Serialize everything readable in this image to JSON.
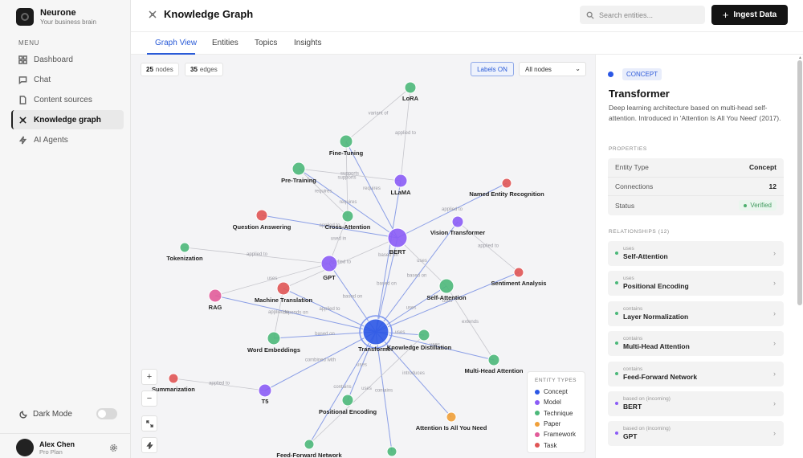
{
  "brand": {
    "name": "Neurone",
    "tagline": "Your business brain"
  },
  "sidebar": {
    "menu_title": "MENU",
    "items": [
      {
        "label": "Dashboard",
        "icon": "grid-icon"
      },
      {
        "label": "Chat",
        "icon": "chat-icon"
      },
      {
        "label": "Content sources",
        "icon": "file-icon"
      },
      {
        "label": "Knowledge graph",
        "icon": "graph-icon",
        "active": true
      },
      {
        "label": "AI Agents",
        "icon": "bolt-icon"
      }
    ],
    "dark_mode_label": "Dark Mode",
    "dark_mode_on": false
  },
  "user": {
    "name": "Alex Chen",
    "plan": "Pro Plan"
  },
  "header": {
    "title": "Knowledge Graph",
    "search_placeholder": "Search entities...",
    "ingest_label": "Ingest Data",
    "ingest_plus": "+"
  },
  "tabs": [
    {
      "label": "Graph View",
      "active": true
    },
    {
      "label": "Entities"
    },
    {
      "label": "Topics"
    },
    {
      "label": "Insights"
    }
  ],
  "graph": {
    "nodes_count": "25",
    "nodes_label": "nodes",
    "edges_count": "35",
    "edges_label": "edges",
    "labels_toggle": "Labels ON",
    "filter_value": "All nodes",
    "zoom_in": "+",
    "zoom_out": "−",
    "legend_title": "ENTITY TYPES",
    "legend": [
      {
        "label": "Concept",
        "color": "#2b57e5"
      },
      {
        "label": "Model",
        "color": "#8b5cf6"
      },
      {
        "label": "Technique",
        "color": "#4cb87a"
      },
      {
        "label": "Paper",
        "color": "#f0a03a"
      },
      {
        "label": "Framework",
        "color": "#e25c9a"
      },
      {
        "label": "Task",
        "color": "#e05555"
      }
    ],
    "nodes": [
      {
        "id": "transformer",
        "label": "Transformer",
        "type": "Concept"
      },
      {
        "id": "bert",
        "label": "BERT",
        "type": "Model"
      },
      {
        "id": "gpt",
        "label": "GPT",
        "type": "Model"
      },
      {
        "id": "llama",
        "label": "LLaMA",
        "type": "Model"
      },
      {
        "id": "t5",
        "label": "T5",
        "type": "Model"
      },
      {
        "id": "vit",
        "label": "Vision Transformer",
        "type": "Model"
      },
      {
        "id": "lora",
        "label": "LoRA",
        "type": "Technique"
      },
      {
        "id": "finetuning",
        "label": "Fine-Tuning",
        "type": "Technique"
      },
      {
        "id": "pretraining",
        "label": "Pre-Training",
        "type": "Technique"
      },
      {
        "id": "crossattn",
        "label": "Cross-Attention",
        "type": "Technique"
      },
      {
        "id": "selfattn",
        "label": "Self-Attention",
        "type": "Technique"
      },
      {
        "id": "tokenization",
        "label": "Tokenization",
        "type": "Technique"
      },
      {
        "id": "wordemb",
        "label": "Word Embeddings",
        "type": "Technique"
      },
      {
        "id": "distill",
        "label": "Knowledge Distillation",
        "type": "Technique"
      },
      {
        "id": "mha",
        "label": "Multi-Head Attention",
        "type": "Technique"
      },
      {
        "id": "posenc",
        "label": "Positional Encoding",
        "type": "Technique"
      },
      {
        "id": "ffn",
        "label": "Feed-Forward Network",
        "type": "Technique"
      },
      {
        "id": "layernorm",
        "label": "",
        "type": "Technique"
      },
      {
        "id": "ner",
        "label": "Named Entity Recognition",
        "type": "Task"
      },
      {
        "id": "qa",
        "label": "Question Answering",
        "type": "Task"
      },
      {
        "id": "mt",
        "label": "Machine Translation",
        "type": "Task"
      },
      {
        "id": "sentiment",
        "label": "Sentiment Analysis",
        "type": "Task"
      },
      {
        "id": "summ",
        "label": "Summarization",
        "type": "Task"
      },
      {
        "id": "rag",
        "label": "RAG",
        "type": "Framework"
      },
      {
        "id": "aiayn",
        "label": "Attention Is All You Need",
        "type": "Paper"
      }
    ],
    "edges": [
      {
        "from": "lora",
        "to": "finetuning",
        "label": "variant of"
      },
      {
        "from": "lora",
        "to": "llama",
        "label": "applied to"
      },
      {
        "from": "finetuning",
        "to": "bert",
        "label": "requires"
      },
      {
        "from": "finetuning",
        "to": "crossattn",
        "label": "supports"
      },
      {
        "from": "pretraining",
        "to": "llama",
        "label": "supports"
      },
      {
        "from": "pretraining",
        "to": "bert",
        "label": "requires"
      },
      {
        "from": "pretraining",
        "to": "crossattn",
        "label": "requires"
      },
      {
        "from": "llama",
        "to": "transformer",
        "label": "based on"
      },
      {
        "from": "ner",
        "to": "bert",
        "label": "applied to"
      },
      {
        "from": "qa",
        "to": "bert",
        "label": "applied to"
      },
      {
        "from": "crossattn",
        "to": "gpt",
        "label": "used in"
      },
      {
        "from": "vit",
        "to": "transformer",
        "label": "based on"
      },
      {
        "from": "vit",
        "to": "sentiment",
        "label": "applied to"
      },
      {
        "from": "bert",
        "to": "transformer",
        "label": "based on"
      },
      {
        "from": "bert",
        "to": "selfattn",
        "label": "uses"
      },
      {
        "from": "bert",
        "to": "mt",
        "label": "applied to"
      },
      {
        "from": "gpt",
        "to": "transformer",
        "label": "based on"
      },
      {
        "from": "gpt",
        "to": "rag",
        "label": "uses"
      },
      {
        "from": "tokenization",
        "to": "gpt",
        "label": "applied to"
      },
      {
        "from": "rag",
        "to": "transformer",
        "label": "depends on"
      },
      {
        "from": "mt",
        "to": "transformer",
        "label": "applied to"
      },
      {
        "from": "wordemb",
        "to": "mt",
        "label": "applied to"
      },
      {
        "from": "wordemb",
        "to": "transformer",
        "label": "based on"
      },
      {
        "from": "selfattn",
        "to": "transformer",
        "label": "uses"
      },
      {
        "from": "selfattn",
        "to": "mha",
        "label": "extends"
      },
      {
        "from": "distill",
        "to": "transformer",
        "label": "uses"
      },
      {
        "from": "mha",
        "to": "transformer",
        "label": "uses"
      },
      {
        "from": "transformer",
        "to": "t5",
        "label": "combined with"
      },
      {
        "from": "summ",
        "to": "t5",
        "label": "applied to"
      },
      {
        "from": "posenc",
        "to": "transformer",
        "label": "uses"
      },
      {
        "from": "aiayn",
        "to": "transformer",
        "label": "introduces"
      },
      {
        "from": "ffn",
        "to": "transformer",
        "label": "contains"
      },
      {
        "from": "layernorm",
        "to": "transformer",
        "label": "contains"
      },
      {
        "from": "distill",
        "to": "ffn",
        "label": "uses"
      },
      {
        "from": "sentiment",
        "to": "transformer",
        "label": "uses"
      }
    ]
  },
  "details": {
    "type_badge": "CONCEPT",
    "title": "Transformer",
    "description": "Deep learning architecture based on multi-head self-attention. Introduced in 'Attention Is All You Need' (2017).",
    "properties_label": "PROPERTIES",
    "properties": [
      {
        "key": "Entity Type",
        "value": "Concept"
      },
      {
        "key": "Connections",
        "value": "12"
      },
      {
        "key": "Status",
        "value": "Verified"
      }
    ],
    "relationships_label": "RELATIONSHIPS (12)",
    "relationships": [
      {
        "type": "uses",
        "name": "Self-Attention",
        "color": "#4cb87a"
      },
      {
        "type": "uses",
        "name": "Positional Encoding",
        "color": "#4cb87a"
      },
      {
        "type": "contains",
        "name": "Layer Normalization",
        "color": "#4cb87a"
      },
      {
        "type": "contains",
        "name": "Multi-Head Attention",
        "color": "#4cb87a"
      },
      {
        "type": "contains",
        "name": "Feed-Forward Network",
        "color": "#4cb87a"
      },
      {
        "type": "based on (incoming)",
        "name": "BERT",
        "color": "#8b5cf6"
      },
      {
        "type": "based on (incoming)",
        "name": "GPT",
        "color": "#8b5cf6"
      }
    ]
  }
}
